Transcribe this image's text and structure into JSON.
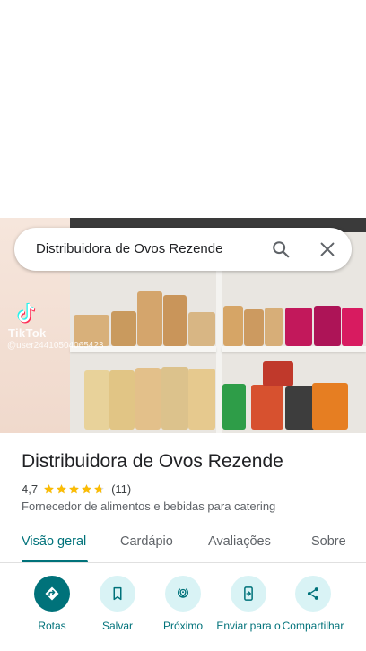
{
  "search": {
    "query": "Distribuidora de Ovos Rezende"
  },
  "photo": {
    "watermark_brand": "TikTok",
    "watermark_user": "@user24410504065423"
  },
  "place": {
    "name": "Distribuidora de Ovos Rezende",
    "rating": "4,7",
    "stars_filled": 4.7,
    "review_count": "(11)",
    "category": "Fornecedor de alimentos e bebidas para catering"
  },
  "tabs": [
    {
      "label": "Visão geral",
      "active": true
    },
    {
      "label": "Cardápio",
      "active": false
    },
    {
      "label": "Avaliações",
      "active": false
    },
    {
      "label": "Sobre",
      "active": false
    }
  ],
  "actions": [
    {
      "label": "Rotas",
      "icon": "directions-icon"
    },
    {
      "label": "Salvar",
      "icon": "bookmark-icon"
    },
    {
      "label": "Próximo",
      "icon": "nearby-icon"
    },
    {
      "label": "Enviar para o",
      "icon": "send-to-phone-icon"
    },
    {
      "label": "Compartilhar",
      "icon": "share-icon"
    }
  ],
  "colors": {
    "accent": "#00727a",
    "chip_bg": "#d9f3f5",
    "star": "#fbbc04"
  }
}
